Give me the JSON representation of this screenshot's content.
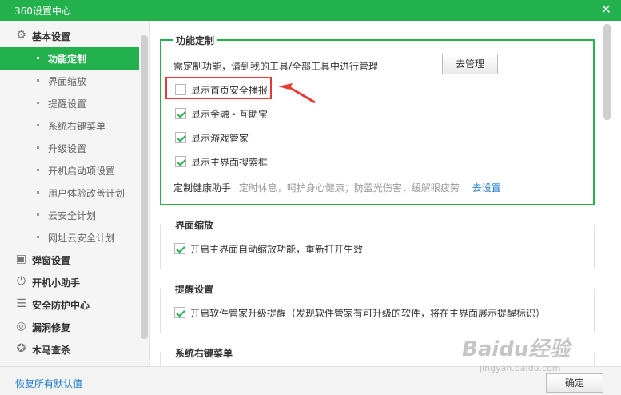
{
  "window": {
    "title": "360设置中心",
    "close_glyph": "✕"
  },
  "sidebar": {
    "groups": [
      {
        "label": "基本设置",
        "icon": "gear-icon",
        "glyph": "⚙"
      },
      {
        "label": "弹窗设置",
        "icon": "window-icon",
        "glyph": "▣"
      },
      {
        "label": "开机小助手",
        "icon": "power-icon",
        "glyph": "⏻"
      },
      {
        "label": "安全防护中心",
        "icon": "sliders-icon",
        "glyph": "☰"
      },
      {
        "label": "漏洞修复",
        "icon": "patch-icon",
        "glyph": "◎"
      },
      {
        "label": "木马查杀",
        "icon": "trojan-icon",
        "glyph": "✪"
      }
    ],
    "items": [
      {
        "label": "功能定制"
      },
      {
        "label": "界面缩放"
      },
      {
        "label": "提醒设置"
      },
      {
        "label": "系统右键菜单"
      },
      {
        "label": "升级设置"
      },
      {
        "label": "开机启动项设置"
      },
      {
        "label": "用户体验改善计划"
      },
      {
        "label": "云安全计划"
      },
      {
        "label": "网址云安全计划"
      }
    ]
  },
  "sections": {
    "custom": {
      "title": "功能定制",
      "hint": "需定制功能，请到我的工具/全部工具中进行管理",
      "manage_button": "去管理",
      "options": [
        {
          "label": "显示首页安全播报",
          "checked": false
        },
        {
          "label": "显示金融・互助宝",
          "checked": true
        },
        {
          "label": "显示游戏管家",
          "checked": true
        },
        {
          "label": "显示主界面搜索框",
          "checked": true
        }
      ],
      "health_label": "定制健康助手",
      "health_desc": "定时休息，呵护身心健康；防蓝光伤害，缓解眼疲劳",
      "health_link": "去设置"
    },
    "zoom": {
      "title": "界面缩放",
      "option": "开启主界面自动缩放功能，重新打开生效",
      "checked": true
    },
    "reminder": {
      "title": "提醒设置",
      "option": "开启软件管家升级提醒（发现软件管家有可升级的软件，将在主界面展示提醒标识）",
      "checked": true
    },
    "context_menu": {
      "title": "系统右键菜单"
    }
  },
  "footer": {
    "restore_link": "恢复所有默认值",
    "ok_button": "确定"
  },
  "colors": {
    "brand_green": "#22b14c",
    "highlight_red": "#e53935",
    "link_blue": "#1f7ccf"
  },
  "watermark": {
    "text": "Baidu经验",
    "sub": "jingyan.baidu.com"
  }
}
